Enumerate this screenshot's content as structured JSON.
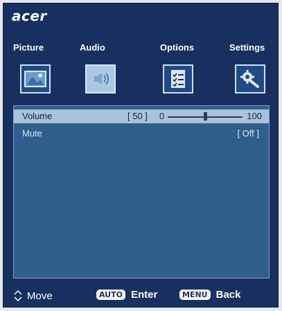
{
  "brand": {
    "logo_text": "acer"
  },
  "tabs": [
    {
      "label": "Picture",
      "icon": "picture-icon"
    },
    {
      "label": "Audio",
      "icon": "speaker-icon",
      "selected": true
    },
    {
      "label": "Options",
      "icon": "checklist-icon"
    },
    {
      "label": "Settings",
      "icon": "gear-wrench-icon"
    }
  ],
  "settings": {
    "volume": {
      "label": "Volume",
      "value_display": "[ 50 ]",
      "min_label": "0",
      "max_label": "100",
      "value": 50,
      "min": 0,
      "max": 100
    },
    "mute": {
      "label": "Mute",
      "value_display": "[ Off ]"
    }
  },
  "footer": {
    "move_label": "Move",
    "enter_key": "AUTO",
    "enter_label": "Enter",
    "back_key": "MENU",
    "back_label": "Back"
  },
  "colors": {
    "background": "#17305f",
    "panel": "#2f5f8c",
    "highlight": "#a9c3dc",
    "selected_tab": "#aac8e6"
  }
}
